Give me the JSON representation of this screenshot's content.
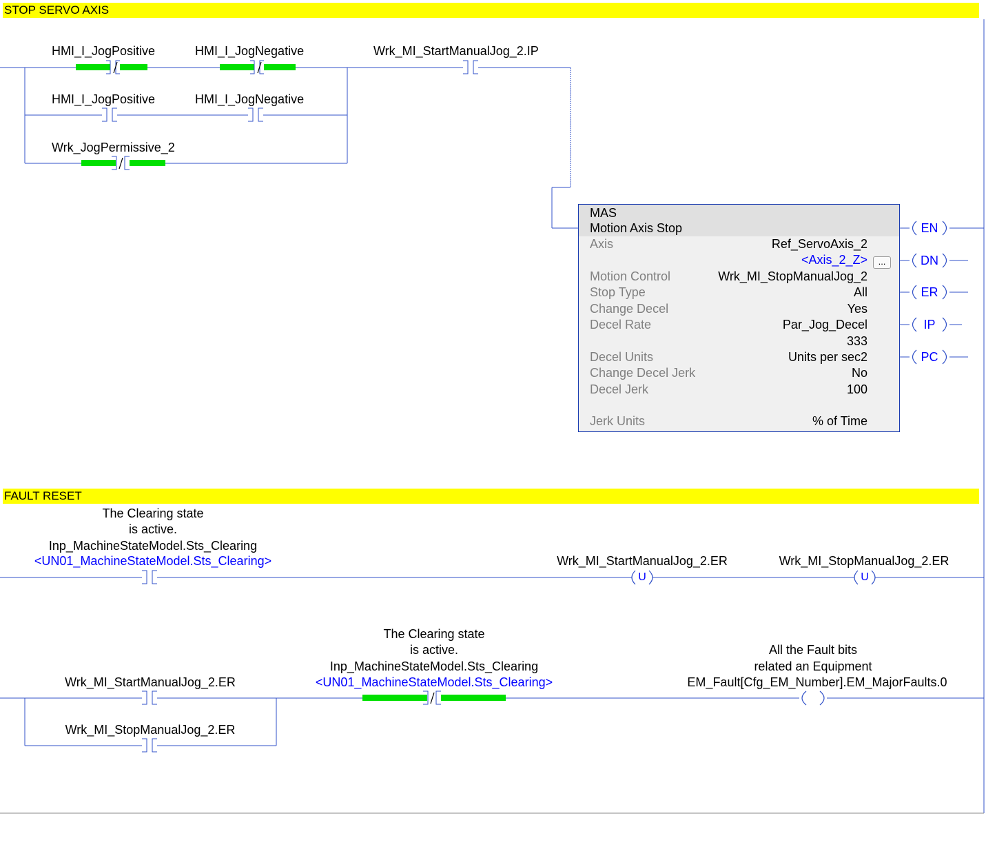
{
  "rungs": {
    "r1_comment": "STOP SERVO AXIS",
    "r1_hmi_pos_1": "HMI_I_JogPositive",
    "r1_hmi_neg_1": "HMI_I_JogNegative",
    "r1_hmi_pos_2": "HMI_I_JogPositive",
    "r1_hmi_neg_2": "HMI_I_JogNegative",
    "r1_permissive": "Wrk_JogPermissive_2",
    "r1_start_ip": "Wrk_MI_StartManualJog_2.IP",
    "r2_comment": "FAULT RESET",
    "r2_desc_1": "The Clearing state",
    "r2_desc_2": "is active.",
    "r2_tag": "Inp_MachineStateModel.Sts_Clearing",
    "r2_alias": "<UN01_MachineStateModel.Sts_Clearing>",
    "r2_unlatch_1": "Wrk_MI_StartManualJog_2.ER",
    "r2_unlatch_2": "Wrk_MI_StopManualJog_2.ER",
    "r3_start_er": "Wrk_MI_StartManualJog_2.ER",
    "r3_stop_er": "Wrk_MI_StopManualJog_2.ER",
    "r3_desc_1": "The Clearing state",
    "r3_desc_2": "is active.",
    "r3_tag": "Inp_MachineStateModel.Sts_Clearing",
    "r3_alias": "<UN01_MachineStateModel.Sts_Clearing>",
    "r3_coil_desc_1": "All the Fault bits",
    "r3_coil_desc_2": "related an Equipment",
    "r3_coil_tag": "EM_Fault[Cfg_EM_Number].EM_MajorFaults.0"
  },
  "instruction": {
    "mnemonic": "MAS",
    "name": "Motion Axis Stop",
    "ellipsis": "...",
    "params": [
      {
        "label": "Axis",
        "value": "Ref_ServoAxis_2"
      },
      {
        "label": "",
        "value": "<Axis_2_Z>"
      },
      {
        "label": "Motion Control",
        "value": "Wrk_MI_StopManualJog_2"
      },
      {
        "label": "Stop Type",
        "value": "All"
      },
      {
        "label": "Change Decel",
        "value": "Yes"
      },
      {
        "label": "Decel Rate",
        "value": "Par_Jog_Decel"
      },
      {
        "label": "",
        "value": "333"
      },
      {
        "label": "Decel Units",
        "value": "Units per sec2"
      },
      {
        "label": "Change Decel Jerk",
        "value": "No"
      },
      {
        "label": "Decel Jerk",
        "value": "100"
      },
      {
        "label": "Jerk Units",
        "value": "% of Time"
      }
    ],
    "outputs": [
      "EN",
      "DN",
      "ER",
      "IP",
      "PC"
    ]
  },
  "symbols": {
    "nc": "/",
    "unlatch": "U"
  },
  "colors": {
    "energized": "#00e000",
    "wire": "#3050c8",
    "banner": "#ffff00",
    "alias": "#0000ff"
  }
}
